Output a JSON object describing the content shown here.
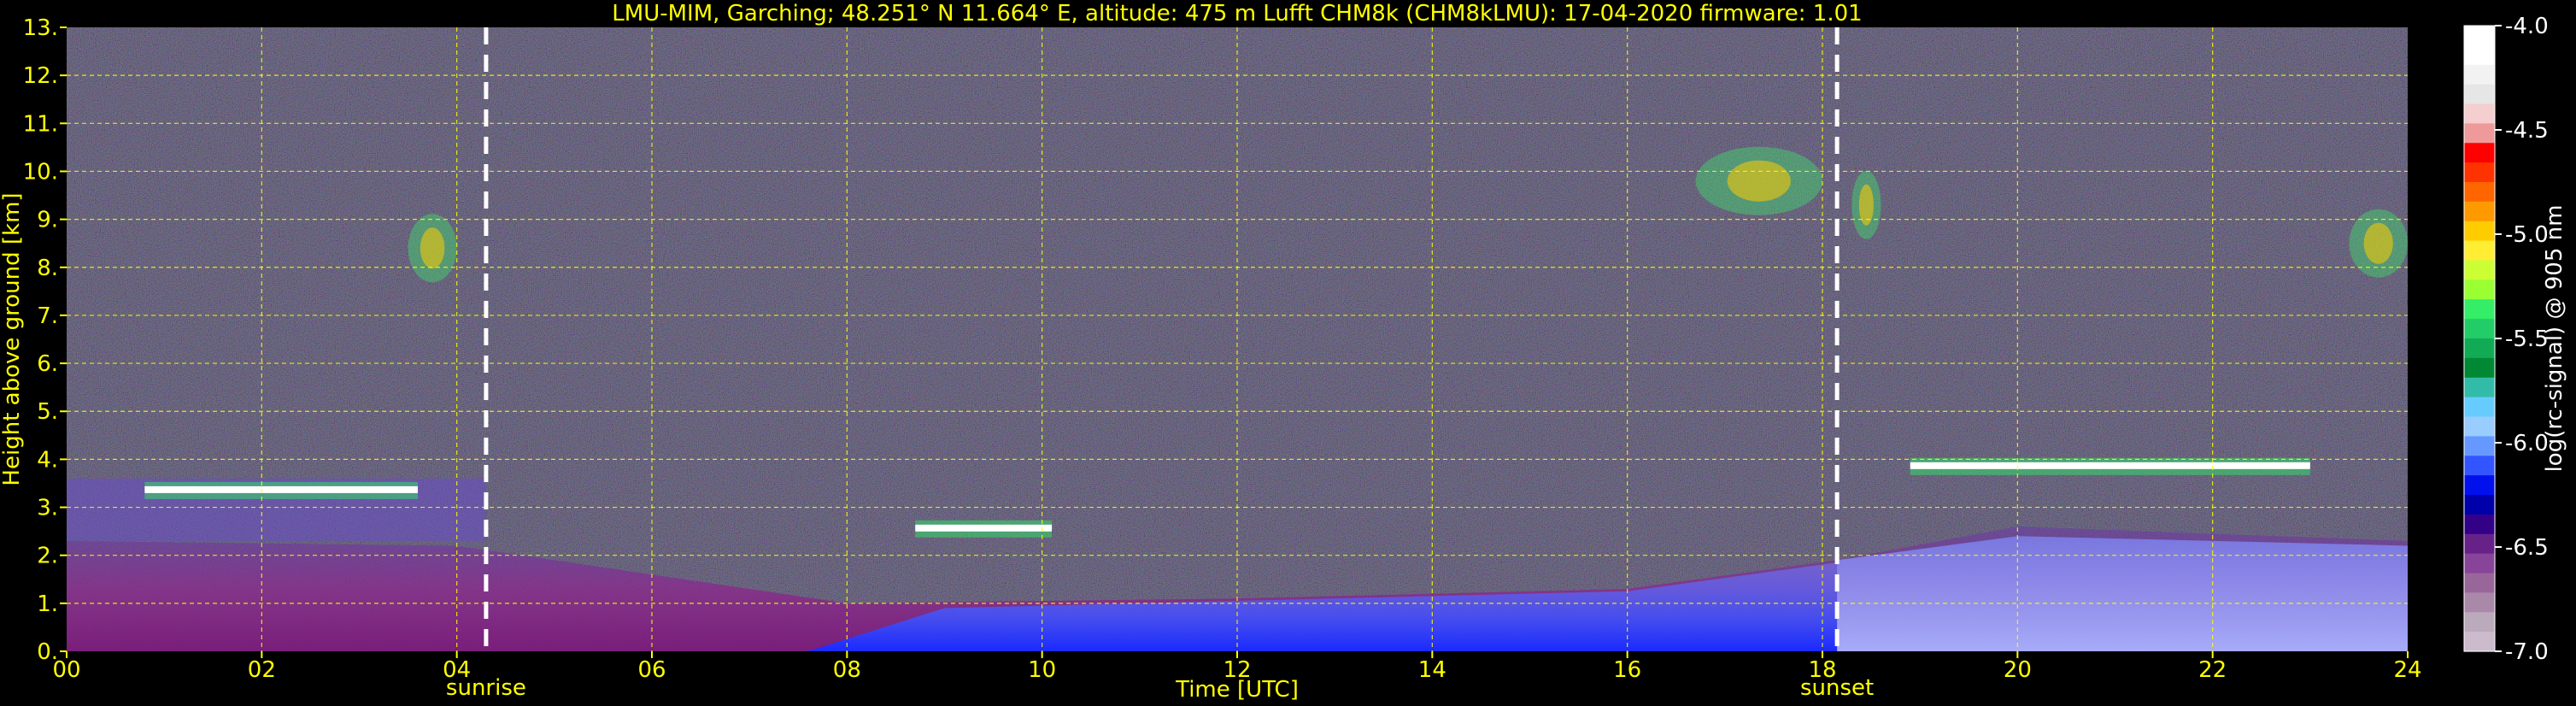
{
  "chart_data": {
    "type": "heatmap",
    "title": "LMU-MIM, Garching; 48.251° N 11.664° E, altitude: 475 m    Lufft CHM8k (CHM8kLMU): 17-04-2020    firmware: 1.01",
    "xlabel": "Time [UTC]",
    "ylabel": "Height above ground [km]",
    "xlim": [
      0,
      24
    ],
    "ylim": [
      0,
      13
    ],
    "x_ticks": [
      "00",
      "02",
      "04",
      "06",
      "08",
      "10",
      "12",
      "14",
      "16",
      "18",
      "20",
      "22",
      "24"
    ],
    "y_ticks": [
      "0.",
      "1.",
      "2.",
      "3.",
      "4.",
      "5.",
      "6.",
      "7.",
      "8.",
      "9.",
      "10.",
      "11.",
      "12.",
      "13."
    ],
    "grid": true,
    "events": [
      {
        "label": "sunrise",
        "time_h": 4.3
      },
      {
        "label": "sunset",
        "time_h": 18.15
      }
    ],
    "colorbar": {
      "label": "log(rc-signal) @ 905 nm",
      "range": [
        -7.0,
        -4.0
      ],
      "ticks": [
        "-4.0",
        "-4.5",
        "-5.0",
        "-5.5",
        "-6.0",
        "-6.5",
        "-7.0"
      ]
    },
    "features": [
      {
        "name": "nocturnal cloud layer",
        "t_start": 0.8,
        "t_end": 3.6,
        "height_km": 3.35
      },
      {
        "name": "cloud patch",
        "t_start": 8.7,
        "t_end": 10.1,
        "height_km": 2.55
      },
      {
        "name": "evening cloud layer",
        "t_start": 18.9,
        "t_end": 23.0,
        "height_km": 3.85
      },
      {
        "name": "cirrus",
        "t_start": 3.5,
        "t_end": 4.0,
        "height_km": 8.4
      },
      {
        "name": "cirrus",
        "t_start": 16.7,
        "t_end": 18.0,
        "height_km": 9.8
      },
      {
        "name": "cirrus",
        "t_start": 18.3,
        "t_end": 18.6,
        "height_km": 9.3
      },
      {
        "name": "cirrus",
        "t_start": 23.4,
        "t_end": 24.0,
        "height_km": 8.5
      }
    ],
    "boundary_layer": [
      {
        "t": 0,
        "h": 2.3
      },
      {
        "t": 4,
        "h": 2.2
      },
      {
        "t": 8,
        "h": 1.0
      },
      {
        "t": 12,
        "h": 1.1
      },
      {
        "t": 16,
        "h": 1.3
      },
      {
        "t": 18.15,
        "h": 1.9
      },
      {
        "t": 20,
        "h": 2.6
      },
      {
        "t": 24,
        "h": 2.3
      }
    ]
  }
}
